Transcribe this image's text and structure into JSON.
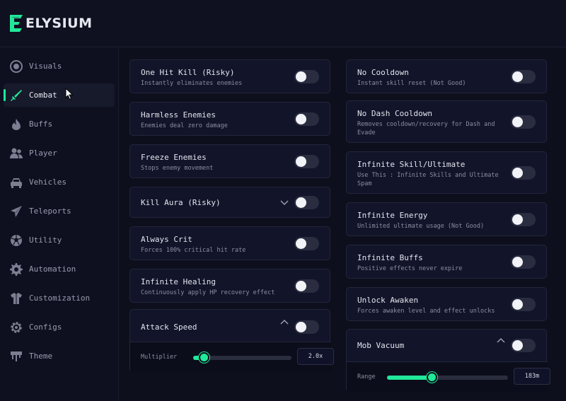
{
  "app": {
    "title": "ELYSIUM",
    "accent": "#22e89a"
  },
  "sidebar": {
    "active": "Combat",
    "items": [
      {
        "label": "Visuals",
        "icon": "eye-icon"
      },
      {
        "label": "Combat",
        "icon": "sword-icon"
      },
      {
        "label": "Buffs",
        "icon": "flame-icon"
      },
      {
        "label": "Player",
        "icon": "users-icon"
      },
      {
        "label": "Vehicles",
        "icon": "car-icon"
      },
      {
        "label": "Teleports",
        "icon": "paper-plane-icon"
      },
      {
        "label": "Utility",
        "icon": "ball-icon"
      },
      {
        "label": "Automation",
        "icon": "gear-icon"
      },
      {
        "label": "Customization",
        "icon": "shirt-icon"
      },
      {
        "label": "Configs",
        "icon": "cog-icon"
      },
      {
        "label": "Theme",
        "icon": "paint-drip-icon"
      }
    ]
  },
  "left": {
    "one_hit_kill": {
      "title": "One Hit Kill (Risky)",
      "desc": "Instantly eliminates enemies",
      "enabled": false
    },
    "harmless_enemies": {
      "title": "Harmless Enemies",
      "desc": "Enemies deal zero damage",
      "enabled": false
    },
    "freeze_enemies": {
      "title": "Freeze Enemies",
      "desc": "Stops enemy movement",
      "enabled": false
    },
    "kill_aura": {
      "title": "Kill Aura (Risky)",
      "enabled": false,
      "expanded": false
    },
    "always_crit": {
      "title": "Always Crit",
      "desc": "Forces 100% critical hit rate",
      "enabled": false
    },
    "infinite_healing": {
      "title": "Infinite Healing",
      "desc": "Continuously apply HP recovery effect",
      "enabled": false
    },
    "attack_speed": {
      "title": "Attack Speed",
      "enabled": false,
      "expanded": true,
      "slider_label": "Multiplier",
      "value": "2.0x",
      "fraction": 0.11
    }
  },
  "right": {
    "no_cooldown": {
      "title": "No Cooldown",
      "desc": "Instant skill reset (Not Good)",
      "enabled": false
    },
    "no_dash_cooldown": {
      "title": "No Dash Cooldown",
      "desc": "Removes cooldown/recovery for Dash and Evade",
      "enabled": false
    },
    "infinite_skill": {
      "title": "Infinite Skill/Ultimate",
      "desc": "Use This : Infinite Skills and Ultimate Spam",
      "enabled": false
    },
    "infinite_energy": {
      "title": "Infinite Energy",
      "desc": "Unlimited ultimate usage (Not Good)",
      "enabled": false
    },
    "infinite_buffs": {
      "title": "Infinite Buffs",
      "desc": "Positive effects never expire",
      "enabled": false
    },
    "unlock_awaken": {
      "title": "Unlock Awaken",
      "desc": "Forces awaken level and effect unlocks",
      "enabled": false
    },
    "mob_vacuum": {
      "title": "Mob Vacuum",
      "enabled": false,
      "expanded": true,
      "slider_label": "Range",
      "value": "183m",
      "fraction": 0.37
    }
  }
}
